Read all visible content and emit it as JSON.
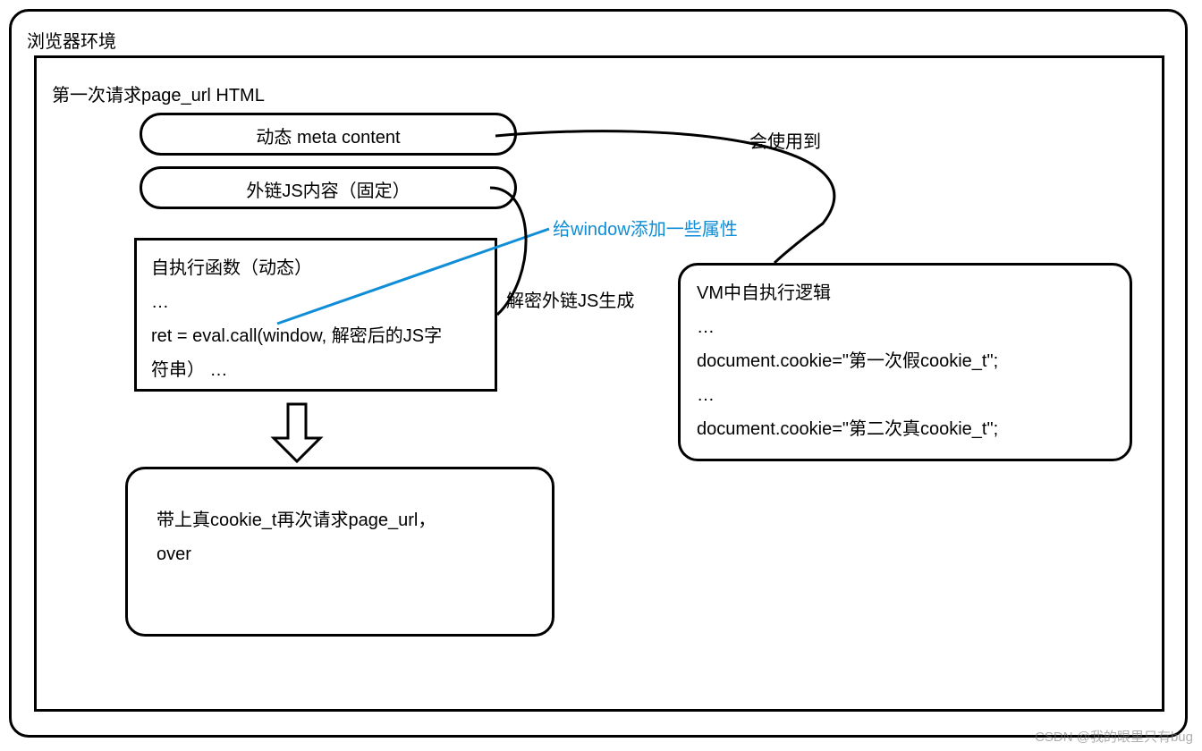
{
  "outer": {
    "title": "浏览器环境"
  },
  "inner": {
    "title": "第一次请求page_url HTML"
  },
  "pills": {
    "meta": "动态 meta  content",
    "js": "外链JS内容（固定）"
  },
  "exec": {
    "l1": "自执行函数（动态）",
    "l2": "…",
    "l3": "ret = eval.call(window, 解密后的JS字",
    "l4": "符串）  …"
  },
  "vm": {
    "l1": "VM中自执行逻辑",
    "l2": "…",
    "l3": "document.cookie=\"第一次假cookie_t\";",
    "l4": "…",
    "l5": "document.cookie=\"第二次真cookie_t\";"
  },
  "final": {
    "l1": "带上真cookie_t再次请求page_url，",
    "l2": "over"
  },
  "annot": {
    "use": "会使用到",
    "prop": "给window添加一些属性",
    "decrypt": "解密外链JS生成"
  },
  "watermark": "CSDN @我的眼里只有bug"
}
